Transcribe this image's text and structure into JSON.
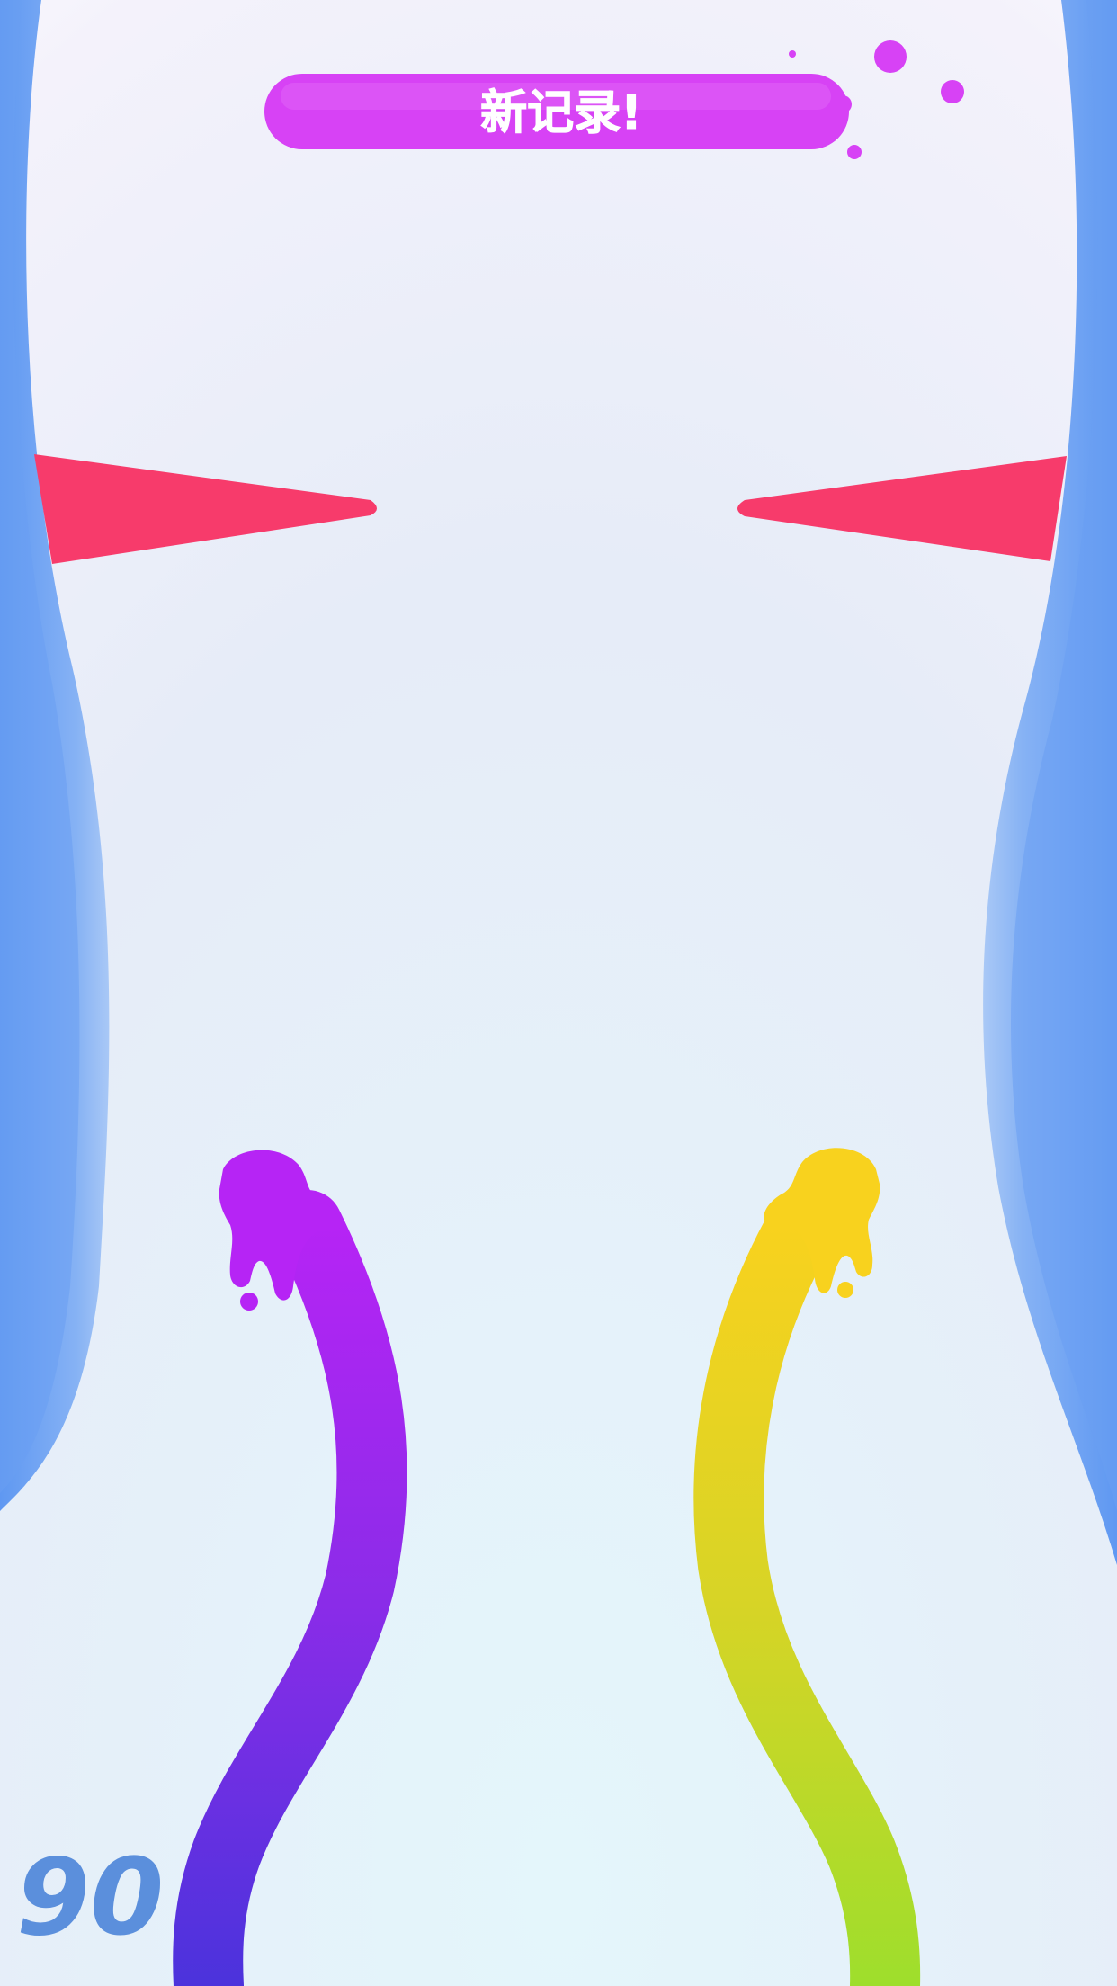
{
  "banner": {
    "text": "新记录!"
  },
  "hud": {
    "score": "90"
  },
  "colors": {
    "banner": "#d742f5",
    "spike": "#f73b6b",
    "wall": "#6ea2f2",
    "left_snake_head": "#b624f5",
    "left_snake_tail": "#4b33dc",
    "right_snake_head": "#f8d21e",
    "right_snake_tail": "#9ede2c",
    "score": "#5b8fdc"
  },
  "icons": {
    "left_snake": "purple-paint-snake",
    "right_snake": "yellow-paint-snake",
    "spikes": "triangle-spike"
  }
}
